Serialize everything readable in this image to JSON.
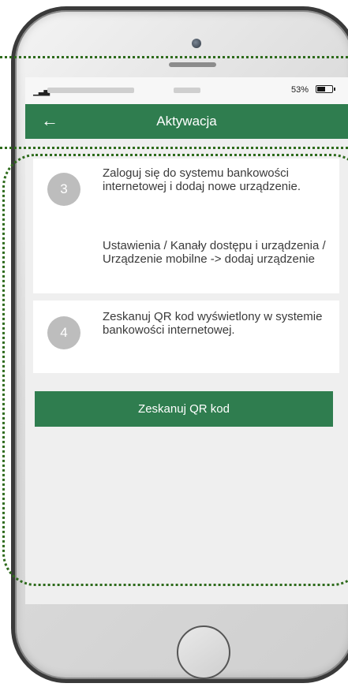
{
  "statusbar": {
    "signal": "▁▃▅",
    "battery_percent": "53%",
    "battery_level": 0.53
  },
  "appbar": {
    "back_icon": "←",
    "title": "Aktywacja"
  },
  "steps": [
    {
      "number": "3",
      "text_1": "Zaloguj się do systemu bankowości internetowej i dodaj nowe urządzenie.",
      "text_2": "Ustawienia / Kanały dostępu i urządzenia / Urządzenie mobilne -> dodaj urządzenie"
    },
    {
      "number": "4",
      "text_1": "Zeskanuj QR kod wyświetlony w systemie bankowości internetowej."
    }
  ],
  "scan_button": {
    "label": "Zeskanuj QR kod"
  },
  "colors": {
    "accent_green": "#2f7d4f",
    "highlight_dotted": "#2e6b1c",
    "step_circle": "#bdbdbd"
  }
}
